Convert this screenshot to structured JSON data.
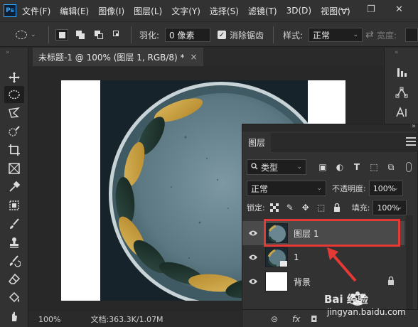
{
  "app": {
    "logo": "Ps"
  },
  "menu": [
    "文件(F)",
    "编辑(E)",
    "图像(I)",
    "图层(L)",
    "文字(Y)",
    "选择(S)",
    "滤镜(T)",
    "3D(D)",
    "视图(V)"
  ],
  "window_controls": {
    "minimize": "—",
    "restore": "❐",
    "close": "✕"
  },
  "options": {
    "feather_label": "羽化:",
    "feather_value": "0 像素",
    "antialias_label": "消除锯齿",
    "antialias_checked": true,
    "style_label": "样式:",
    "style_value": "正常",
    "width_label": "宽度:"
  },
  "document_tab": {
    "title": "未标题-1 @ 100% (图层 1, RGB/8) *",
    "close": "×"
  },
  "status": {
    "zoom": "100%",
    "doc_info": "文档:363.3K/1.07M"
  },
  "layers_panel": {
    "tab": "图层",
    "filter_kind": "类型",
    "blend_mode": "正常",
    "opacity_label": "不透明度:",
    "opacity_value": "100%",
    "lock_label": "锁定:",
    "fill_label": "填充:",
    "fill_value": "100%",
    "layers": [
      {
        "name": "图层 1",
        "visible": true,
        "selected": true
      },
      {
        "name": "1",
        "visible": true,
        "selected": false
      },
      {
        "name": "背景",
        "visible": true,
        "selected": false,
        "locked": true
      }
    ],
    "footer": {
      "link": "⊝",
      "fx": "fx"
    }
  },
  "watermark": {
    "text": "jingyan.baidu.com",
    "logo_text": "Bai 经验"
  },
  "colors": {
    "annotation": "#e53935",
    "accent": "#31a8ff"
  }
}
